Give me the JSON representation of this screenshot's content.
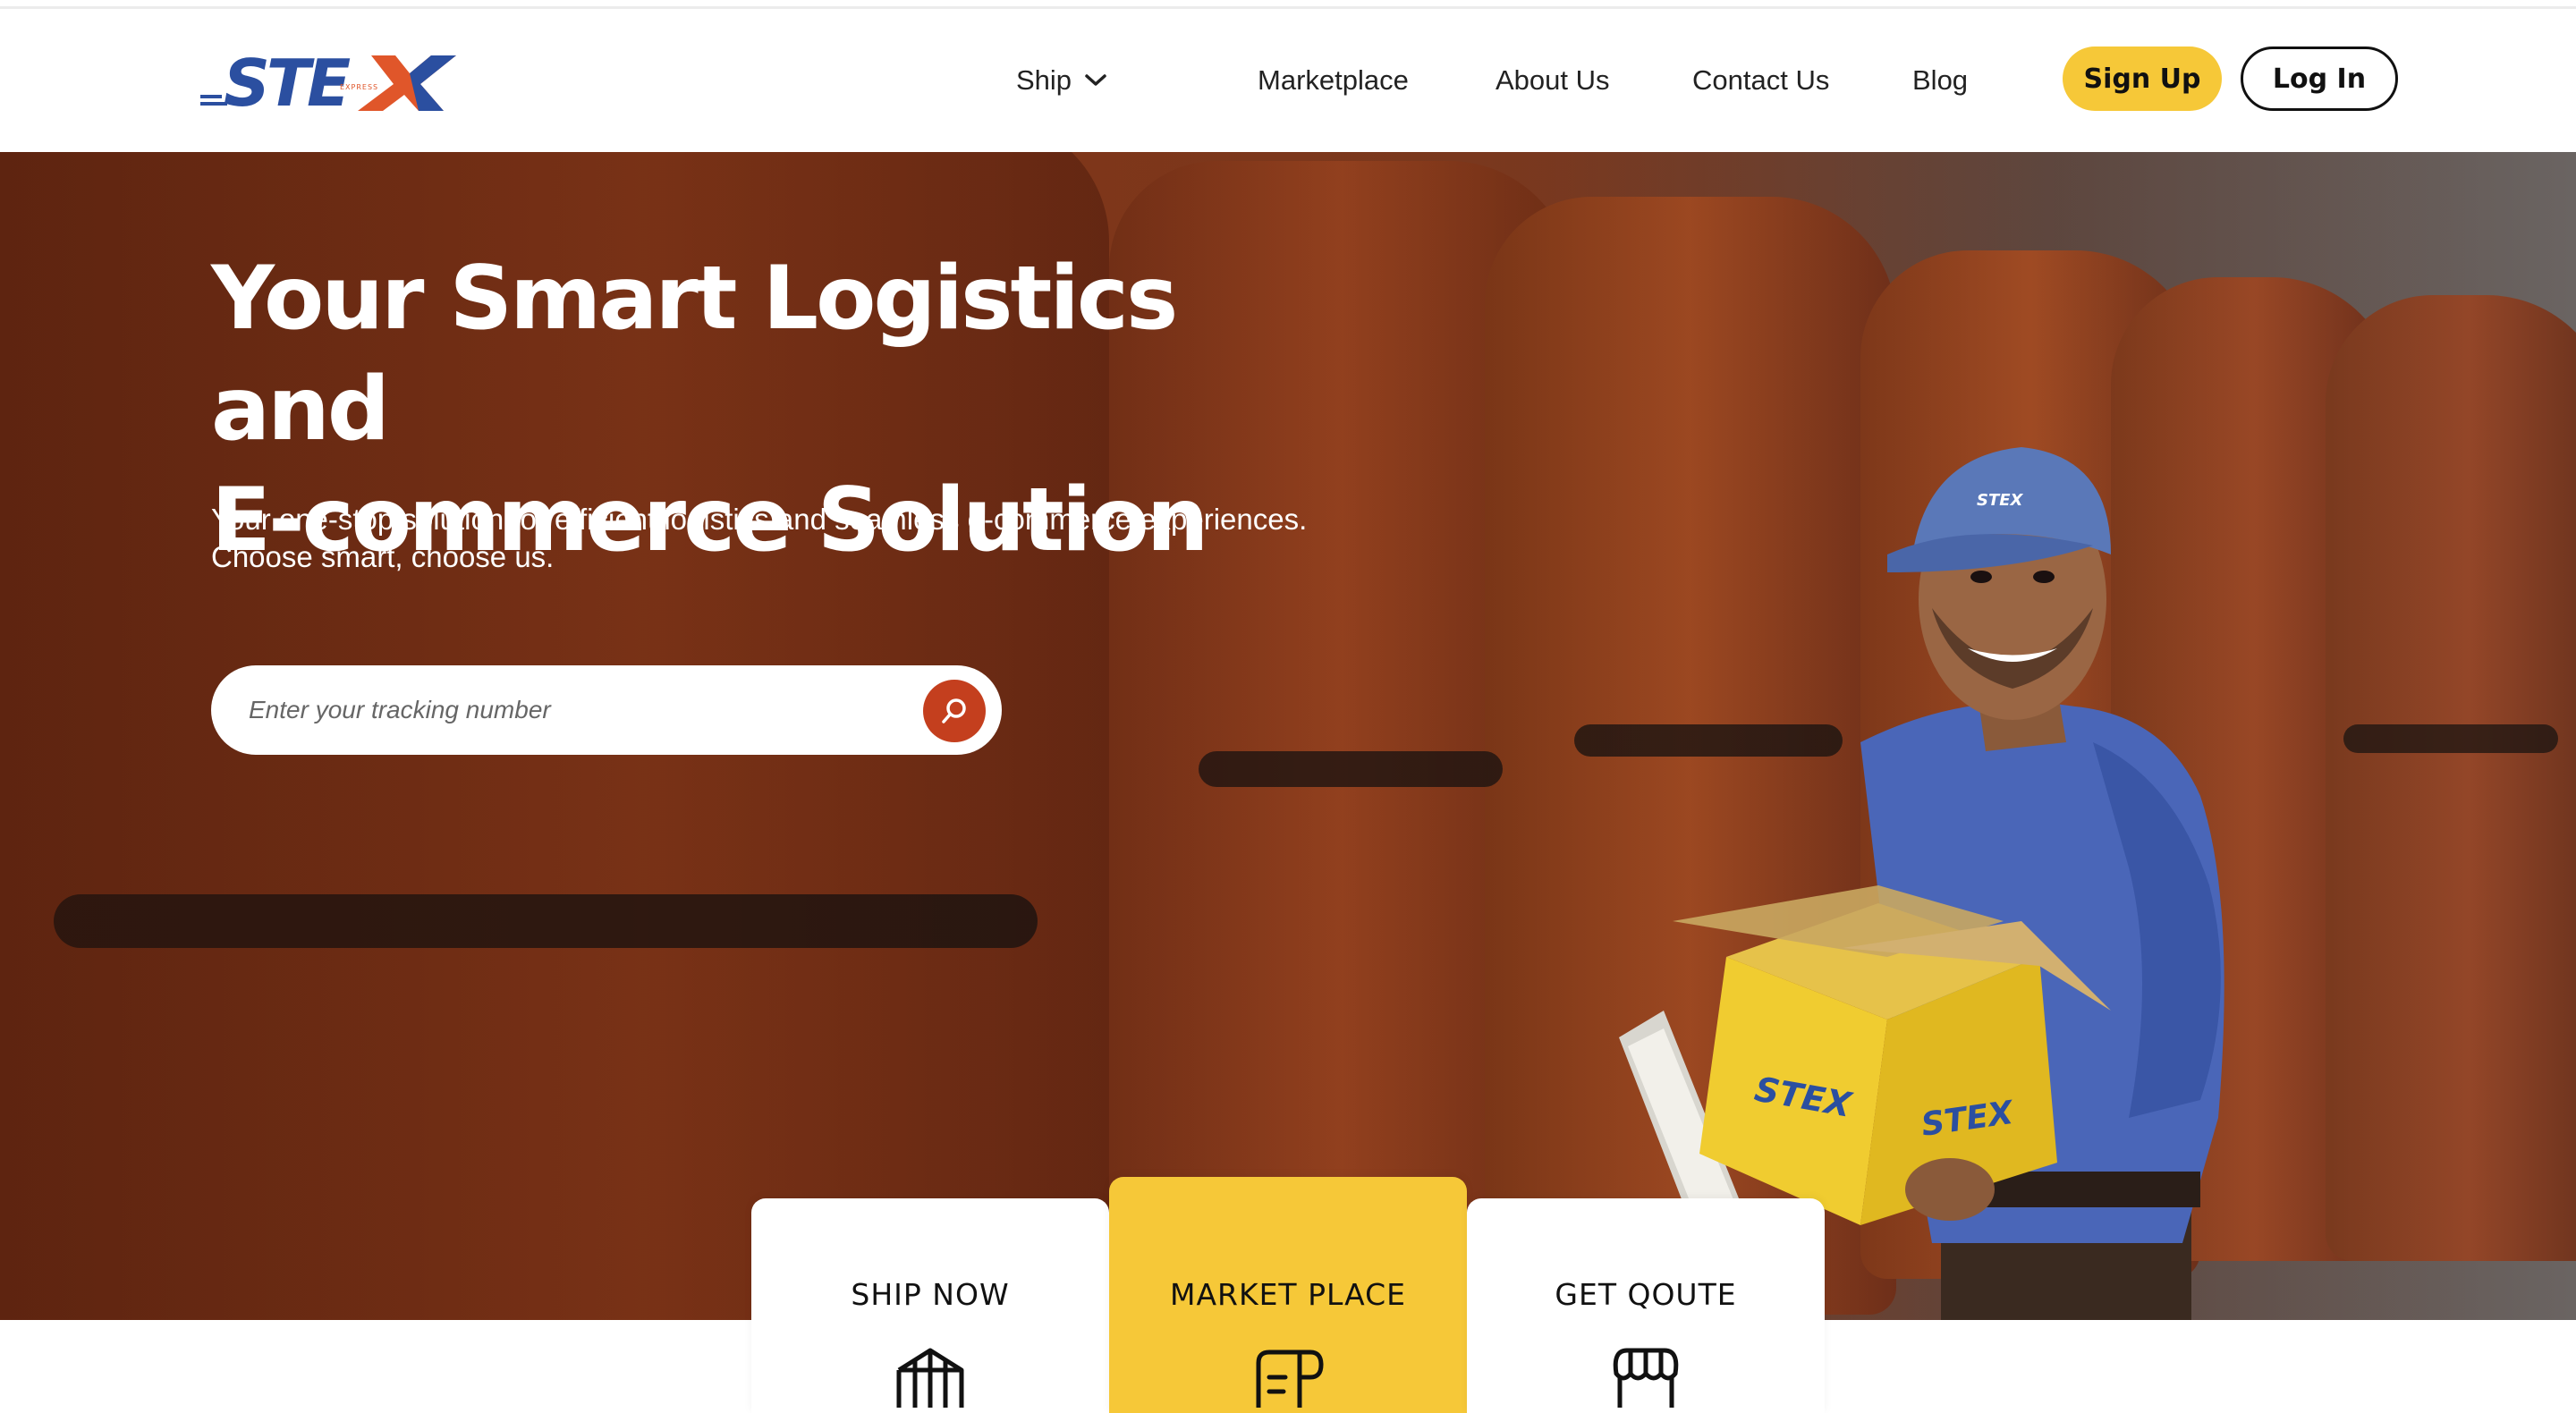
{
  "brand": {
    "logo_text": "STEX",
    "logo_subtext": "EXPRESS",
    "primary_color": "#2b4fa0",
    "accent_color": "#e0562a",
    "yellow": "#f6c838"
  },
  "nav": {
    "items": [
      {
        "label": "Ship",
        "has_dropdown": true
      },
      {
        "label": "Marketplace"
      },
      {
        "label": "About Us"
      },
      {
        "label": "Contact Us"
      },
      {
        "label": "Blog"
      }
    ],
    "signup_label": "Sign Up",
    "login_label": "Log In"
  },
  "hero": {
    "title_line1": "Your Smart Logistics and",
    "title_line2": "E-commerce Solution",
    "subtitle_line1": "Your one-stop solution for efficient logistics and seamless e-commerce experiences.",
    "subtitle_line2": "Choose smart, choose us.",
    "tracking_placeholder": "Enter your tracking number",
    "tracking_value": ""
  },
  "cards": [
    {
      "label": "SHIP NOW",
      "icon": "box-icon"
    },
    {
      "label": "MARKET PLACE",
      "icon": "receipt-icon"
    },
    {
      "label": "GET QOUTE",
      "icon": "shop-icon"
    }
  ]
}
